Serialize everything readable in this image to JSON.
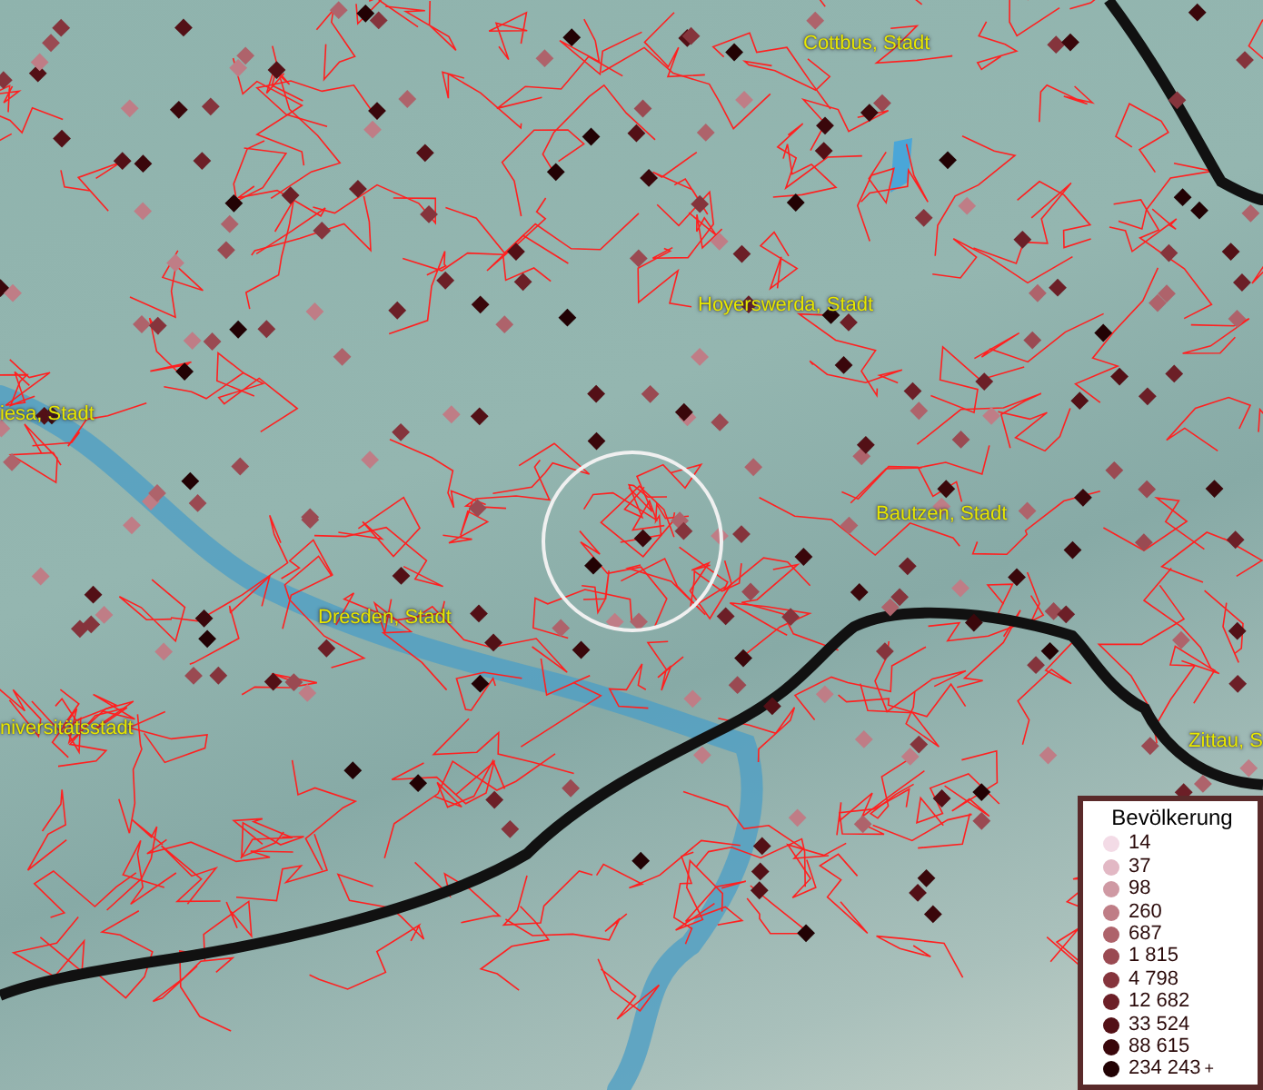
{
  "places": [
    {
      "name": "Cottbus, Stadt"
    },
    {
      "name": "Hoyerswerda, Stadt"
    },
    {
      "name": "iesa, Stadt"
    },
    {
      "name": "Bautzen, Stadt"
    },
    {
      "name": "Dresden, Stadt"
    },
    {
      "name": "niversitätsstadt"
    },
    {
      "name": "Zittau, S"
    }
  ],
  "legend": {
    "title": "Bevölkerung",
    "items": [
      {
        "label": "14",
        "color": "#f3dbe6"
      },
      {
        "label": "37",
        "color": "#e2b8c4"
      },
      {
        "label": "98",
        "color": "#cf99a3"
      },
      {
        "label": "260",
        "color": "#bf7d86"
      },
      {
        "label": "687",
        "color": "#ae636b"
      },
      {
        "label": "1 815",
        "color": "#9a4a52"
      },
      {
        "label": "4 798",
        "color": "#85343c"
      },
      {
        "label": "12 682",
        "color": "#6c1f27"
      },
      {
        "label": "33 524",
        "color": "#531016"
      },
      {
        "label": "88 615",
        "color": "#3a070b"
      },
      {
        "label": "234 243",
        "color": "#220204"
      }
    ],
    "overflow_mark": "+"
  }
}
